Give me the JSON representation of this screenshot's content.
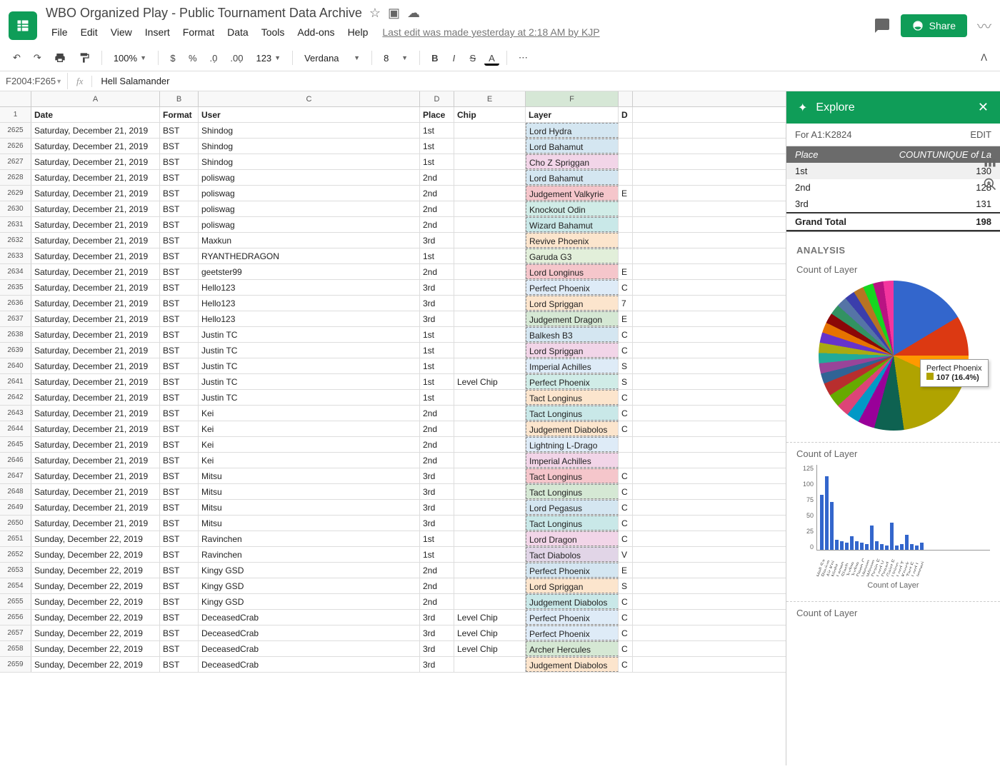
{
  "doc_title": "WBO Organized Play - Public Tournament Data Archive",
  "menus": [
    "File",
    "Edit",
    "View",
    "Insert",
    "Format",
    "Data",
    "Tools",
    "Add-ons",
    "Help"
  ],
  "last_edit": "Last edit was made yesterday at 2:18 AM by KJP",
  "share_label": "Share",
  "toolbar": {
    "zoom": "100%",
    "font": "Verdana",
    "font_size": "8"
  },
  "name_box": "F2004:F265",
  "formula": "Hell Salamander",
  "columns": [
    "A",
    "B",
    "C",
    "D",
    "E",
    "F"
  ],
  "header_row": {
    "date": "Date",
    "format": "Format",
    "user": "User",
    "place": "Place",
    "chip": "Chip",
    "layer": "Layer",
    "next": "D"
  },
  "rows": [
    {
      "n": 2625,
      "date": "Saturday, December 21, 2019",
      "fmt": "BST",
      "user": "Shindog",
      "place": "1st",
      "chip": "",
      "layer": "Lord Hydra",
      "cls": "c-blue"
    },
    {
      "n": 2626,
      "date": "Saturday, December 21, 2019",
      "fmt": "BST",
      "user": "Shindog",
      "place": "1st",
      "chip": "",
      "layer": "Lord Bahamut",
      "cls": "c-blue"
    },
    {
      "n": 2627,
      "date": "Saturday, December 21, 2019",
      "fmt": "BST",
      "user": "Shindog",
      "place": "1st",
      "chip": "",
      "layer": "Cho Z Spriggan",
      "cls": "c-pink"
    },
    {
      "n": 2628,
      "date": "Saturday, December 21, 2019",
      "fmt": "BST",
      "user": "poliswag",
      "place": "2nd",
      "chip": "",
      "layer": "Lord Bahamut",
      "cls": "c-blue"
    },
    {
      "n": 2629,
      "date": "Saturday, December 21, 2019",
      "fmt": "BST",
      "user": "poliswag",
      "place": "2nd",
      "chip": "",
      "layer": "Judgement Valkyrie",
      "cls": "c-red",
      "ext": "E"
    },
    {
      "n": 2630,
      "date": "Saturday, December 21, 2019",
      "fmt": "BST",
      "user": "poliswag",
      "place": "2nd",
      "chip": "",
      "layer": "Knockout Odin",
      "cls": "c-cyan"
    },
    {
      "n": 2631,
      "date": "Saturday, December 21, 2019",
      "fmt": "BST",
      "user": "poliswag",
      "place": "2nd",
      "chip": "",
      "layer": "Wizard Bahamut",
      "cls": "c-teal"
    },
    {
      "n": 2632,
      "date": "Saturday, December 21, 2019",
      "fmt": "BST",
      "user": "Maxkun",
      "place": "3rd",
      "chip": "",
      "layer": "Revive Phoenix",
      "cls": "c-orange"
    },
    {
      "n": 2633,
      "date": "Saturday, December 21, 2019",
      "fmt": "BST",
      "user": "RYANTHEDRAGON",
      "place": "1st",
      "chip": "",
      "layer": "Garuda G3",
      "cls": "c-lgreen"
    },
    {
      "n": 2634,
      "date": "Saturday, December 21, 2019",
      "fmt": "BST",
      "user": "geetster99",
      "place": "2nd",
      "chip": "",
      "layer": "Lord Longinus",
      "cls": "c-red",
      "ext": "E"
    },
    {
      "n": 2635,
      "date": "Saturday, December 21, 2019",
      "fmt": "BST",
      "user": "Hello123",
      "place": "3rd",
      "chip": "",
      "layer": "Perfect Phoenix",
      "cls": "c-lblue",
      "ext": "C"
    },
    {
      "n": 2636,
      "date": "Saturday, December 21, 2019",
      "fmt": "BST",
      "user": "Hello123",
      "place": "3rd",
      "chip": "",
      "layer": "Lord Spriggan",
      "cls": "c-orange",
      "ext": "7"
    },
    {
      "n": 2637,
      "date": "Saturday, December 21, 2019",
      "fmt": "BST",
      "user": "Hello123",
      "place": "3rd",
      "chip": "",
      "layer": "Judgement Dragon",
      "cls": "c-green",
      "ext": "E"
    },
    {
      "n": 2638,
      "date": "Saturday, December 21, 2019",
      "fmt": "BST",
      "user": "Justin TC",
      "place": "1st",
      "chip": "",
      "layer": "Balkesh B3",
      "cls": "c-blue",
      "ext": "C"
    },
    {
      "n": 2639,
      "date": "Saturday, December 21, 2019",
      "fmt": "BST",
      "user": "Justin TC",
      "place": "1st",
      "chip": "",
      "layer": "Lord Spriggan",
      "cls": "c-pink",
      "ext": "C"
    },
    {
      "n": 2640,
      "date": "Saturday, December 21, 2019",
      "fmt": "BST",
      "user": "Justin TC",
      "place": "1st",
      "chip": "",
      "layer": "Imperial Achilles",
      "cls": "c-lblue",
      "ext": "S"
    },
    {
      "n": 2641,
      "date": "Saturday, December 21, 2019",
      "fmt": "BST",
      "user": "Justin TC",
      "place": "1st",
      "chip": "Level Chip",
      "layer": "Perfect Phoenix",
      "cls": "c-cyan",
      "ext": "S"
    },
    {
      "n": 2642,
      "date": "Saturday, December 21, 2019",
      "fmt": "BST",
      "user": "Justin TC",
      "place": "1st",
      "chip": "",
      "layer": "Tact Longinus",
      "cls": "c-orange",
      "ext": "C"
    },
    {
      "n": 2643,
      "date": "Saturday, December 21, 2019",
      "fmt": "BST",
      "user": "Kei",
      "place": "2nd",
      "chip": "",
      "layer": "Tact Longinus",
      "cls": "c-teal",
      "ext": "C"
    },
    {
      "n": 2644,
      "date": "Saturday, December 21, 2019",
      "fmt": "BST",
      "user": "Kei",
      "place": "2nd",
      "chip": "",
      "layer": "Judgement Diabolos",
      "cls": "c-orange",
      "ext": "C"
    },
    {
      "n": 2645,
      "date": "Saturday, December 21, 2019",
      "fmt": "BST",
      "user": "Kei",
      "place": "2nd",
      "chip": "",
      "layer": "Lightning L-Drago",
      "cls": "c-lblue"
    },
    {
      "n": 2646,
      "date": "Saturday, December 21, 2019",
      "fmt": "BST",
      "user": "Kei",
      "place": "2nd",
      "chip": "",
      "layer": "Imperial Achilles",
      "cls": "c-pink"
    },
    {
      "n": 2647,
      "date": "Saturday, December 21, 2019",
      "fmt": "BST",
      "user": "Mitsu",
      "place": "3rd",
      "chip": "",
      "layer": "Tact Longinus",
      "cls": "c-red",
      "ext": "C"
    },
    {
      "n": 2648,
      "date": "Saturday, December 21, 2019",
      "fmt": "BST",
      "user": "Mitsu",
      "place": "3rd",
      "chip": "",
      "layer": "Tact Longinus",
      "cls": "c-green",
      "ext": "C"
    },
    {
      "n": 2649,
      "date": "Saturday, December 21, 2019",
      "fmt": "BST",
      "user": "Mitsu",
      "place": "3rd",
      "chip": "",
      "layer": "Lord Pegasus",
      "cls": "c-blue",
      "ext": "C"
    },
    {
      "n": 2650,
      "date": "Saturday, December 21, 2019",
      "fmt": "BST",
      "user": "Mitsu",
      "place": "3rd",
      "chip": "",
      "layer": "Tact Longinus",
      "cls": "c-teal",
      "ext": "C"
    },
    {
      "n": 2651,
      "date": "Sunday, December 22, 2019",
      "fmt": "BST",
      "user": "Ravinchen",
      "place": "1st",
      "chip": "",
      "layer": "Lord Dragon",
      "cls": "c-pink",
      "ext": "C"
    },
    {
      "n": 2652,
      "date": "Sunday, December 22, 2019",
      "fmt": "BST",
      "user": "Ravinchen",
      "place": "1st",
      "chip": "",
      "layer": "Tact Diabolos",
      "cls": "c-purple",
      "ext": "V"
    },
    {
      "n": 2653,
      "date": "Sunday, December 22, 2019",
      "fmt": "BST",
      "user": "Kingy GSD",
      "place": "2nd",
      "chip": "",
      "layer": "Perfect Phoenix",
      "cls": "c-blue",
      "ext": "E"
    },
    {
      "n": 2654,
      "date": "Sunday, December 22, 2019",
      "fmt": "BST",
      "user": "Kingy GSD",
      "place": "2nd",
      "chip": "",
      "layer": "Lord Spriggan",
      "cls": "c-orange",
      "ext": "S"
    },
    {
      "n": 2655,
      "date": "Sunday, December 22, 2019",
      "fmt": "BST",
      "user": "Kingy GSD",
      "place": "2nd",
      "chip": "",
      "layer": "Judgement Diabolos",
      "cls": "c-teal",
      "ext": "C"
    },
    {
      "n": 2656,
      "date": "Sunday, December 22, 2019",
      "fmt": "BST",
      "user": "DeceasedCrab",
      "place": "3rd",
      "chip": "Level Chip",
      "layer": "Perfect Phoenix",
      "cls": "c-lblue",
      "ext": "C"
    },
    {
      "n": 2657,
      "date": "Sunday, December 22, 2019",
      "fmt": "BST",
      "user": "DeceasedCrab",
      "place": "3rd",
      "chip": "Level Chip",
      "layer": "Perfect Phoenix",
      "cls": "c-lblue",
      "ext": "C"
    },
    {
      "n": 2658,
      "date": "Sunday, December 22, 2019",
      "fmt": "BST",
      "user": "DeceasedCrab",
      "place": "3rd",
      "chip": "Level Chip",
      "layer": "Archer Hercules",
      "cls": "c-green",
      "ext": "C"
    },
    {
      "n": 2659,
      "date": "Sunday, December 22, 2019",
      "fmt": "BST",
      "user": "DeceasedCrab",
      "place": "3rd",
      "chip": "",
      "layer": "Judgement Diabolos",
      "cls": "c-orange",
      "ext": "C"
    }
  ],
  "explore": {
    "title": "Explore",
    "range": "For A1:K2824",
    "edit": "EDIT",
    "pivot": {
      "head_l": "Place",
      "head_r": "COUNTUNIQUE of La",
      "rows": [
        {
          "l": "1st",
          "r": "130"
        },
        {
          "l": "2nd",
          "r": "128"
        },
        {
          "l": "3rd",
          "r": "131"
        }
      ],
      "total_l": "Grand Total",
      "total_r": "198"
    },
    "analysis_label": "ANALYSIS",
    "pie_title": "Count of Layer",
    "tooltip_name": "Perfect Phoenix",
    "tooltip_val": "107 (16.4%)",
    "bar_title": "Count of Layer",
    "bar_axis": "Count of Layer",
    "bar_title2": "Count of Layer"
  },
  "chart_data": {
    "pie": {
      "type": "pie",
      "title": "Count of Layer",
      "highlighted": {
        "name": "Perfect Phoenix",
        "count": 107,
        "pct": 16.4
      },
      "note": "Many thin slices; only highlighted slice labeled in screenshot"
    },
    "bar": {
      "type": "bar",
      "title": "Count of Layer",
      "xlabel": "Count of Layer",
      "ylabel": "",
      "ylim": [
        0,
        125
      ],
      "y_ticks": [
        0,
        25,
        50,
        75,
        100,
        125
      ],
      "categories": [
        "Hell Sa…",
        "Revive…",
        "Air Kni…",
        "Night…",
        "Legen…",
        "Slash…",
        "Judge…",
        "Judge…",
        "Deep C…",
        "Venom…",
        "Winom…",
        "Drain F…",
        "Lord V…",
        "Dread…",
        "Geist F…",
        "Union…",
        "Lord T…",
        "Knock…",
        "Tact F…",
        "Lord L…",
        "Imperi…"
      ],
      "values": [
        80,
        107,
        70,
        15,
        12,
        10,
        20,
        12,
        10,
        8,
        35,
        12,
        8,
        6,
        40,
        6,
        8,
        22,
        8,
        6,
        10
      ]
    }
  }
}
